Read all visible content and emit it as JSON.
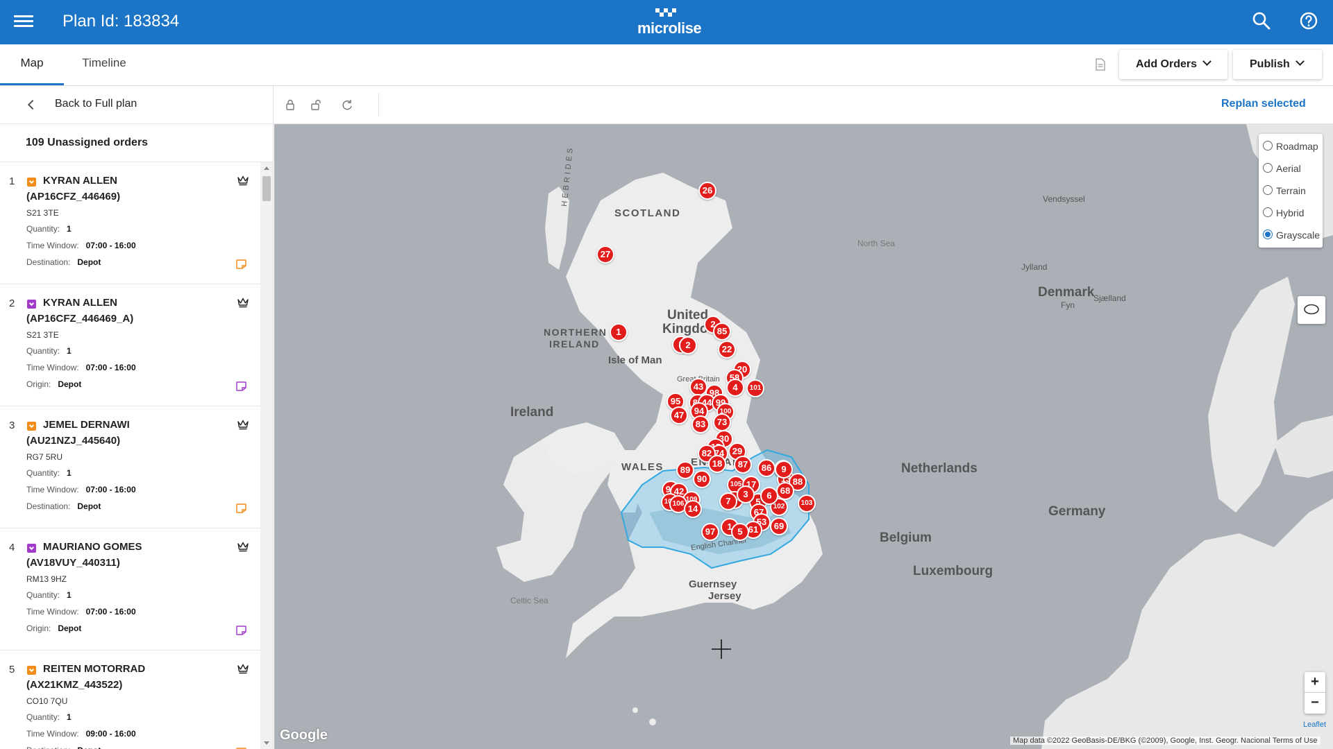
{
  "header": {
    "plan_title": "Plan Id: 183834",
    "brand": "microlise"
  },
  "tabs": [
    {
      "label": "Map",
      "active": true
    },
    {
      "label": "Timeline",
      "active": false
    }
  ],
  "actions": {
    "add_orders": "Add Orders",
    "publish": "Publish"
  },
  "sidebar": {
    "back_label": "Back to Full plan",
    "count_label": "109 Unassigned orders",
    "labels": {
      "quantity": "Quantity:",
      "time_window": "Time Window:",
      "destination": "Destination:",
      "origin": "Origin:"
    },
    "orders": [
      {
        "num": "1",
        "name": "KYRAN ALLEN",
        "ref": "(AP16CFZ_446469)",
        "postcode": "S21 3TE",
        "quantity": "1",
        "time_window": "07:00 - 16:00",
        "loc_type": "destination",
        "location": "Depot",
        "color": "#f28c1b"
      },
      {
        "num": "2",
        "name": "KYRAN ALLEN",
        "ref": "(AP16CFZ_446469_A)",
        "postcode": "S21 3TE",
        "quantity": "1",
        "time_window": "07:00 - 16:00",
        "loc_type": "origin",
        "location": "Depot",
        "color": "#a23cc8"
      },
      {
        "num": "3",
        "name": "JEMEL DERNAWI",
        "ref": "(AU21NZJ_445640)",
        "postcode": "RG7 5RU",
        "quantity": "1",
        "time_window": "07:00 - 16:00",
        "loc_type": "destination",
        "location": "Depot",
        "color": "#f28c1b"
      },
      {
        "num": "4",
        "name": "MAURIANO GOMES",
        "ref": "(AV18VUY_440311)",
        "postcode": "RM13 9HZ",
        "quantity": "1",
        "time_window": "07:00 - 16:00",
        "loc_type": "origin",
        "location": "Depot",
        "color": "#a23cc8"
      },
      {
        "num": "5",
        "name": "REITEN MOTORRAD",
        "ref": "(AX21KMZ_443522)",
        "postcode": "CO10 7QU",
        "quantity": "1",
        "time_window": "09:00 - 16:00",
        "loc_type": "destination",
        "location": "Depot",
        "color": "#f28c1b"
      }
    ]
  },
  "toolbar": {
    "replan": "Replan selected"
  },
  "map": {
    "layers": [
      {
        "label": "Roadmap",
        "selected": false
      },
      {
        "label": "Aerial",
        "selected": false
      },
      {
        "label": "Terrain",
        "selected": false
      },
      {
        "label": "Hybrid",
        "selected": false
      },
      {
        "label": "Grayscale",
        "selected": true
      }
    ],
    "labels": {
      "scotland": "SCOTLAND",
      "hebrides": "HEBRIDES",
      "north_sea": "North Sea",
      "northern_ireland_1": "NORTHERN",
      "northern_ireland_2": "IRELAND",
      "uk_1": "United",
      "uk_2": "Kingdom",
      "isle_of_man": "Isle of Man",
      "great_britain": "Great Britain",
      "ireland": "Ireland",
      "wales": "WALES",
      "england": "ENGLAND",
      "english_channel": "English Channel",
      "celtic_sea": "Celtic Sea",
      "guernsey": "Guernsey",
      "jersey": "Jersey",
      "denmark": "Denmark",
      "jylland": "Jylland",
      "fyn": "Fyn",
      "sjaelland": "Sjælland",
      "vendsyssel": "Vendsyssel",
      "netherlands": "Netherlands",
      "belgium": "Belgium",
      "luxembourg": "Luxembourg",
      "germany": "Germany"
    },
    "markers": [
      "26",
      "27",
      "1",
      "2",
      "85",
      "3",
      "2",
      "22",
      "20",
      "58",
      "4",
      "101",
      "43",
      "98",
      "95",
      "84",
      "44",
      "99",
      "100",
      "47",
      "94",
      "83",
      "73",
      "30",
      "15",
      "74",
      "29",
      "82",
      "18",
      "87",
      "89",
      "90",
      "86",
      "9",
      "93",
      "42",
      "109",
      "107",
      "106",
      "14",
      "105",
      "17",
      "13",
      "88",
      "104",
      "5",
      "68",
      "103",
      "67",
      "102",
      "53",
      "97",
      "1",
      "61",
      "69",
      "7",
      "3",
      "5",
      "6",
      "9"
    ],
    "attribution": "Map data ©2022 GeoBasis-DE/BKG (©2009), Google, Inst. Geogr. Nacional   Terms of Use",
    "leaflet": "Leaflet",
    "google": "Google",
    "zoom_in": "+",
    "zoom_out": "−"
  },
  "colors": {
    "primary": "#1b74c5",
    "marker": "#e21b1b",
    "destination_badge": "#f28c1b",
    "origin_badge": "#a23cc8"
  }
}
